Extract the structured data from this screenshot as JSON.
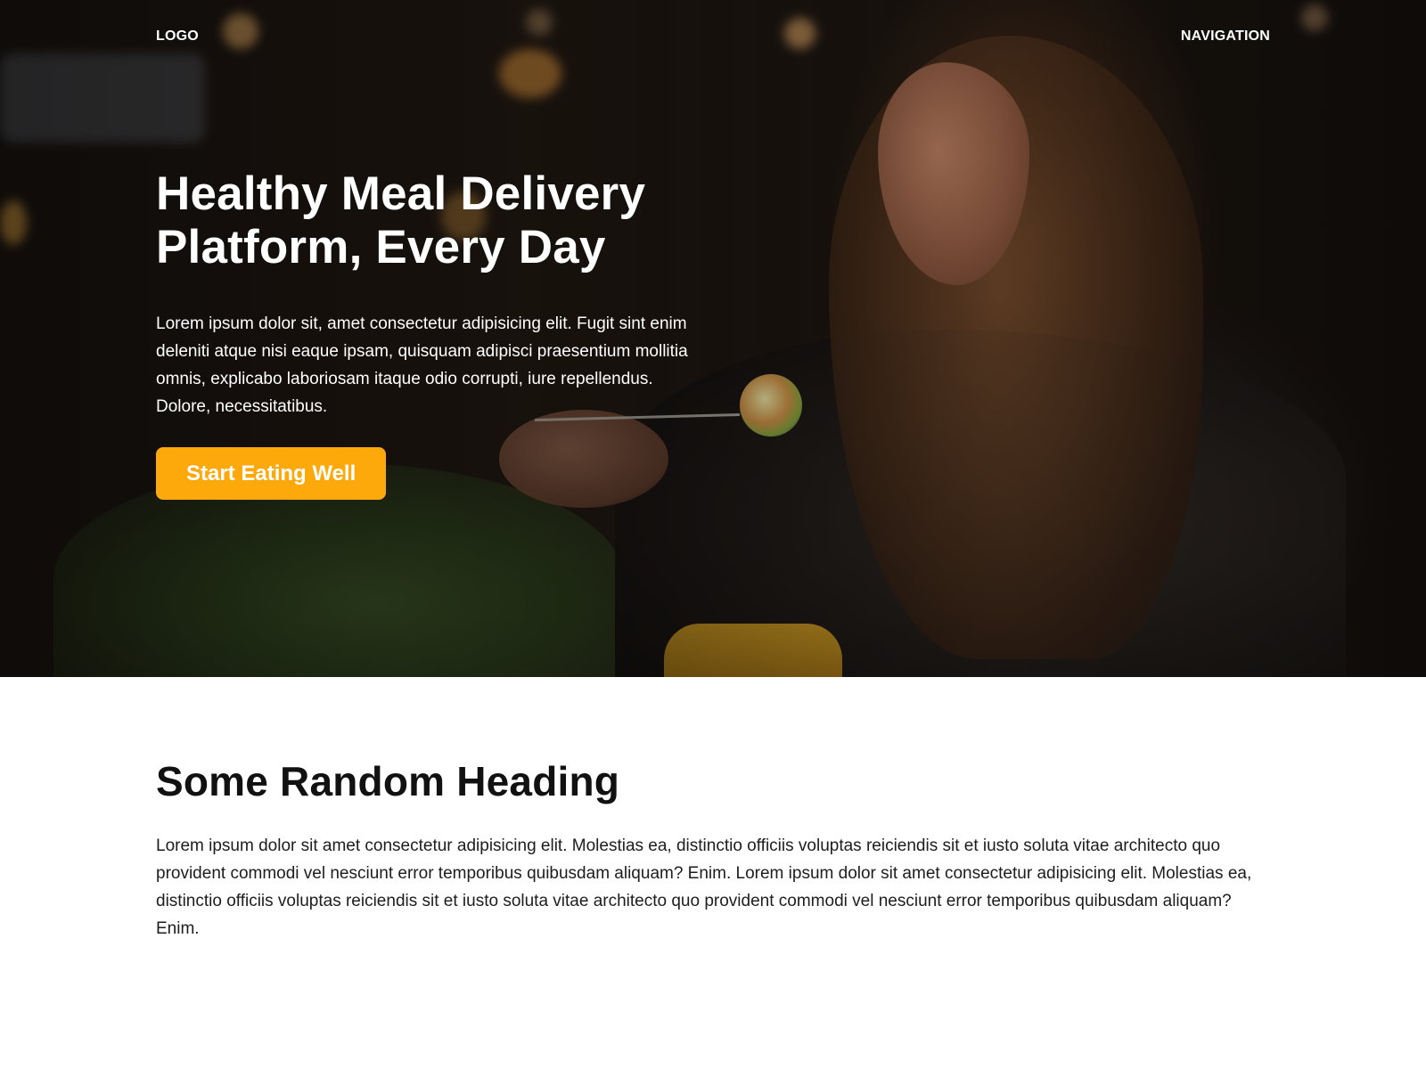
{
  "header": {
    "logo_label": "LOGO",
    "nav_label": "NAVIGATION"
  },
  "hero": {
    "title_line1": "Healthy Meal Delivery",
    "title_line2": "Platform, Every Day",
    "description": "Lorem ipsum dolor sit, amet consectetur adipisicing elit. Fugit sint enim deleniti atque nisi eaque ipsam, quisquam adipisci praesentium mollitia omnis, explicabo laboriosam itaque odio corrupti, iure repellendus. Dolore, necessitatibus.",
    "cta_label": "Start Eating Well",
    "image_subject": "woman-eating-in-restaurant-photo"
  },
  "section": {
    "heading": "Some Random Heading",
    "body": "Lorem ipsum dolor sit amet consectetur adipisicing elit. Molestias ea, distinctio officiis voluptas reiciendis sit et iusto soluta vitae architecto quo provident commodi vel nesciunt error temporibus quibusdam aliquam? Enim. Lorem ipsum dolor sit amet consectetur adipisicing elit. Molestias ea, distinctio officiis voluptas reiciendis sit et iusto soluta vitae architecto quo provident commodi vel nesciunt error temporibus quibusdam aliquam? Enim."
  },
  "colors": {
    "accent": "#fda90c",
    "hero_text": "#ffffff",
    "body_text": "#1d1d1d"
  }
}
